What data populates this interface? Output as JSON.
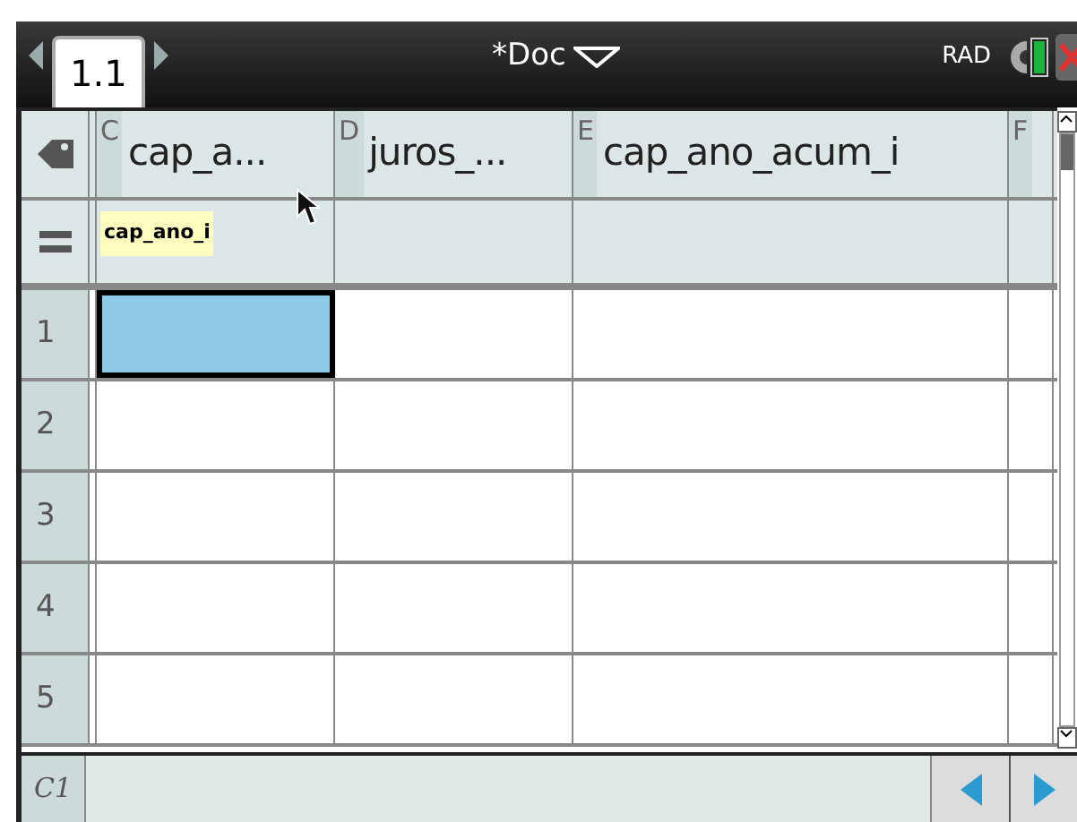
{
  "tabs": [
    {
      "label": "1.1",
      "selected": true
    }
  ],
  "document": {
    "title": "*Doc"
  },
  "angle_mode": "RAD",
  "columns": [
    {
      "letter": "C",
      "name": "cap_a..."
    },
    {
      "letter": "D",
      "name": "juros_..."
    },
    {
      "letter": "E",
      "name": "cap_ano_acum_i"
    },
    {
      "letter": "F"
    }
  ],
  "formula_row": {
    "tooltip": "cap_ano_i"
  },
  "rows": [
    {
      "number": "1",
      "cells": [
        {
          "selected": true
        },
        {
          "selected": false
        },
        {
          "selected": false
        },
        {
          "selected": false
        }
      ]
    },
    {
      "number": "2",
      "cells": [
        {
          "selected": false
        },
        {
          "selected": false
        },
        {
          "selected": false
        },
        {
          "selected": false
        }
      ]
    },
    {
      "number": "3",
      "cells": [
        {
          "selected": false
        },
        {
          "selected": false
        },
        {
          "selected": false
        },
        {
          "selected": false
        }
      ]
    },
    {
      "number": "4",
      "cells": [
        {
          "selected": false
        },
        {
          "selected": false
        },
        {
          "selected": false
        },
        {
          "selected": false
        }
      ]
    },
    {
      "number": "5",
      "cells": [
        {
          "selected": false
        },
        {
          "selected": false
        },
        {
          "selected": false
        },
        {
          "selected": false
        }
      ]
    }
  ],
  "status_bar": {
    "cell_ref": "C1"
  }
}
